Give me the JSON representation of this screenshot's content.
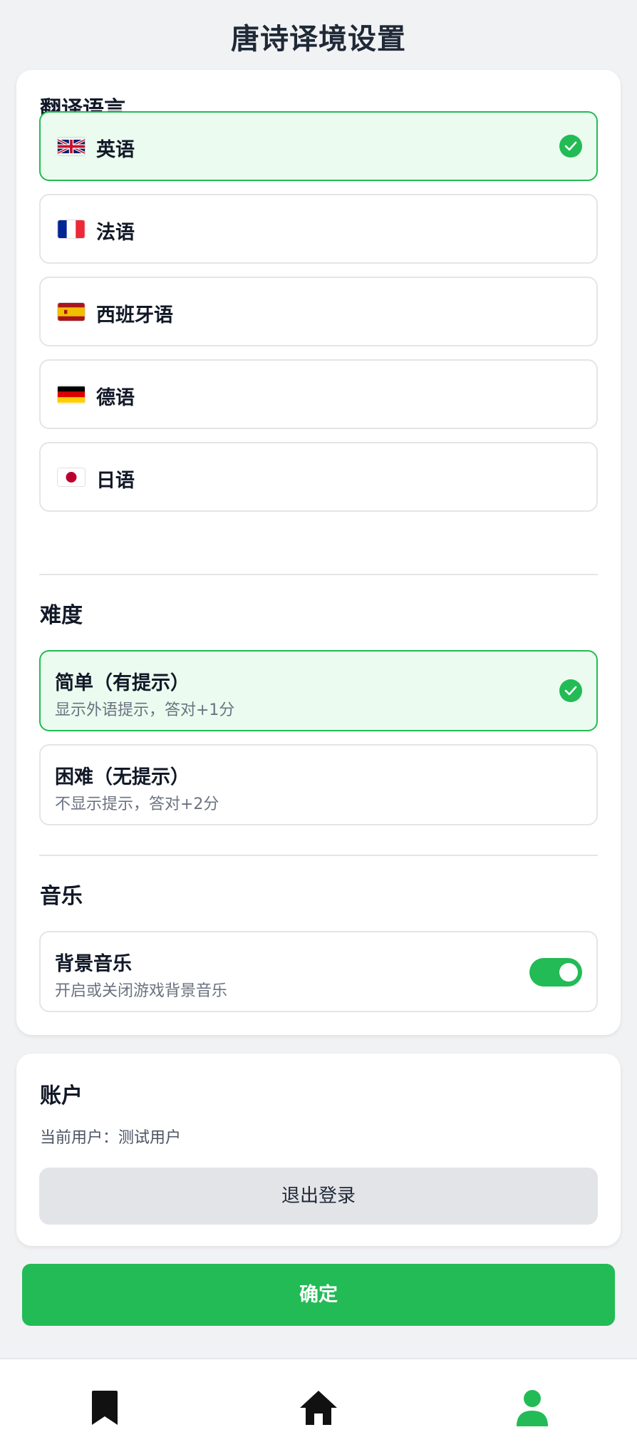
{
  "header": {
    "title": "唐诗译境设置"
  },
  "language_section": {
    "title": "翻译语言",
    "options": [
      {
        "label": "英语",
        "flag": "uk-flag-icon",
        "selected": true
      },
      {
        "label": "法语",
        "flag": "france-flag-icon",
        "selected": false
      },
      {
        "label": "西班牙语",
        "flag": "spain-flag-icon",
        "selected": false
      },
      {
        "label": "德语",
        "flag": "germany-flag-icon",
        "selected": false
      },
      {
        "label": "日语",
        "flag": "japan-flag-icon",
        "selected": false
      }
    ]
  },
  "difficulty_section": {
    "title": "难度",
    "options": [
      {
        "title": "简单（有提示）",
        "desc": "显示外语提示，答对+1分",
        "selected": true
      },
      {
        "title": "困难（无提示）",
        "desc": "不显示提示，答对+2分",
        "selected": false
      }
    ]
  },
  "music_section": {
    "title": "音乐",
    "bg_music": {
      "title": "背景音乐",
      "desc": "开启或关闭游戏背景音乐",
      "enabled": true
    }
  },
  "account_section": {
    "title": "账户",
    "current_user": "当前用户：测试用户",
    "logout_label": "退出登录"
  },
  "confirm_label": "确定",
  "bottom_nav": {
    "items": [
      {
        "icon": "bookmark-icon",
        "active": false
      },
      {
        "icon": "home-icon",
        "active": false
      },
      {
        "icon": "user-icon",
        "active": true
      }
    ]
  },
  "colors": {
    "accent": "#22bb55",
    "selected_bg": "#ebfbef",
    "background": "#f1f2f4",
    "icon_inactive": "#111111"
  }
}
